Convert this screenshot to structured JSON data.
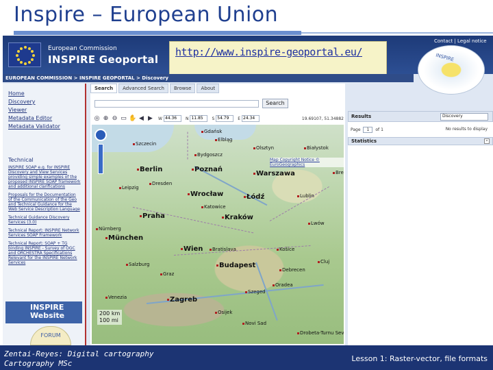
{
  "slide": {
    "title": "Inspire – European Union",
    "footer_left_line1": "Zentai-Reyes: Digital cartography",
    "footer_left_line2": "Cartography MSc",
    "footer_right": "Lesson 1: Raster-vector, file formats"
  },
  "portal": {
    "ec_label": "European Commission",
    "portal_label": "INSPIRE Geoportal",
    "url": "http://www.inspire-geoportal.eu/",
    "top_links": "Contact | Legal notice",
    "breadcrumb": "EUROPEAN COMMISSION > INSPIRE GEOPORTAL > Discovery",
    "badge_text": "INSPIRE",
    "website_label_1": "INSPIRE",
    "website_label_2": "Website",
    "forum_label": "FORUM"
  },
  "sidebar": {
    "nav": [
      "Home",
      "Discovery",
      "Viewer",
      "Metadata Editor",
      "Metadata Validator"
    ],
    "technical_heading": "Technical",
    "technical_links": [
      "INSPIRE SOAP e.g. for INSPIRE Discovery and View Services providing simple examples of the proposed INSPIRE SOAP framework and additional clarifications",
      "Proposals for the Documentation of the Communication of the Geo and Technical Guidance for the Web Service Description Language",
      "Technical Guidance Discovery Services (3.0)",
      "Technical Report: INSPIRE Network Services SOAP Framework",
      "Technical Report: SOAP + TG binding INSPIRE - Survey of OGC and ORCHESTRA Specifications Relevant for the INSPIRE Network Services"
    ]
  },
  "main": {
    "tabs": [
      "Search",
      "Advanced Search",
      "Browse",
      "About"
    ],
    "search_button": "Search",
    "coords": {
      "w": "44.36",
      "n": "11.85",
      "s": "54.79",
      "e": "24.34"
    },
    "coord_labels": {
      "w": "W",
      "n": "N",
      "s": "S",
      "e": "E"
    },
    "status": "19.69107, 51.34882",
    "copyright": "Map Copyright Notice © EuroGeographics",
    "scale_km": "200 km",
    "scale_mi": "100 mi",
    "cities": [
      {
        "name": "Gdańsk",
        "big": false
      },
      {
        "name": "Elbląg",
        "big": false
      },
      {
        "name": "Szczecin",
        "big": false
      },
      {
        "name": "Bydgoszcz",
        "big": false
      },
      {
        "name": "Olsztyn",
        "big": false
      },
      {
        "name": "Białystok",
        "big": false
      },
      {
        "name": "Berlin",
        "big": true
      },
      {
        "name": "Poznań",
        "big": true
      },
      {
        "name": "Warszawa",
        "big": true
      },
      {
        "name": "Łódź",
        "big": true
      },
      {
        "name": "Brest",
        "big": false
      },
      {
        "name": "Leipzig",
        "big": false
      },
      {
        "name": "Dresden",
        "big": false
      },
      {
        "name": "Wrocław",
        "big": true
      },
      {
        "name": "Lublin",
        "big": false
      },
      {
        "name": "Praha",
        "big": true
      },
      {
        "name": "Kraków",
        "big": true
      },
      {
        "name": "Katowice",
        "big": false
      },
      {
        "name": "Lwów",
        "big": false
      },
      {
        "name": "Nürnberg",
        "big": false
      },
      {
        "name": "München",
        "big": true
      },
      {
        "name": "Wien",
        "big": true
      },
      {
        "name": "Bratislava",
        "big": false
      },
      {
        "name": "Košice",
        "big": false
      },
      {
        "name": "Budapest",
        "big": true
      },
      {
        "name": "Graz",
        "big": false
      },
      {
        "name": "Salzburg",
        "big": false
      },
      {
        "name": "Debrecen",
        "big": false
      },
      {
        "name": "Zagreb",
        "big": true
      },
      {
        "name": "Szeged",
        "big": false
      },
      {
        "name": "Oradea",
        "big": false
      },
      {
        "name": "Cluj",
        "big": false
      },
      {
        "name": "Venezia",
        "big": false
      },
      {
        "name": "Osijek",
        "big": false
      },
      {
        "name": "Novi Sad",
        "big": false
      },
      {
        "name": "Drobeta-Turnu Severin",
        "big": false
      }
    ]
  },
  "right": {
    "results_label": "Results",
    "results_select": "Discovery",
    "page_label": "Page",
    "page_value": "1",
    "page_of": "of 1",
    "no_results": "No results to display",
    "statistics_label": "Statistics"
  },
  "colors": {
    "title_blue": "#1f3f8f",
    "footer_navy": "#1c3473",
    "banner_blue": "#1d3a78"
  }
}
